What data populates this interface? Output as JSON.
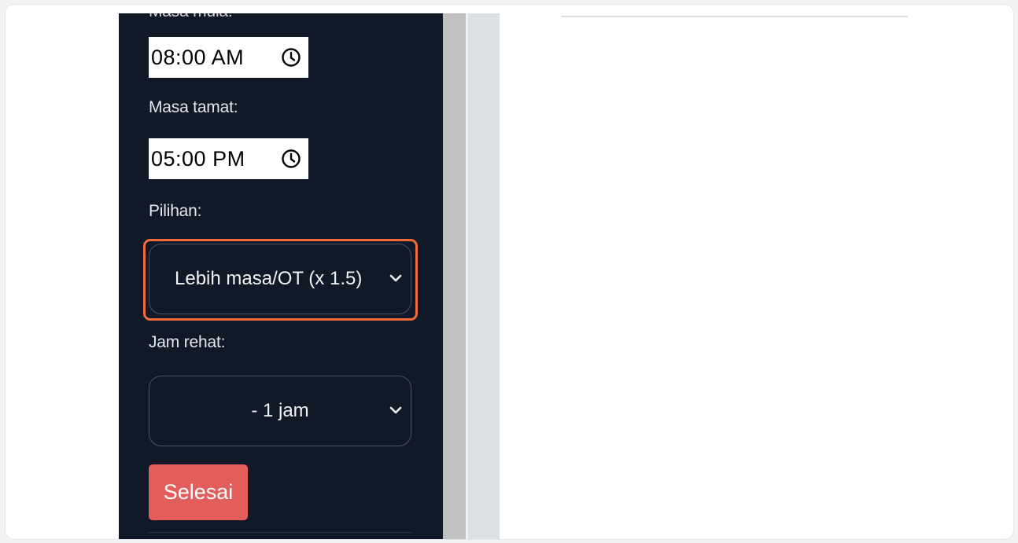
{
  "form": {
    "start_time_label_cut": "Masa mula:",
    "start_time_value": "08:00  AM",
    "end_time_label": "Masa tamat:",
    "end_time_value": "05:00  PM",
    "option_label": "Pilihan:",
    "option_selected": "Lebih masa/OT (x 1.5)",
    "break_label": "Jam rehat:",
    "break_selected": "- 1 jam",
    "submit_label": "Selesai"
  },
  "icons": {
    "time_picker": "clock-icon",
    "dropdown": "chevron-down-icon"
  },
  "colors": {
    "panel_bg": "#111827",
    "focus_ring": "#f26b3a",
    "submit_bg": "#e35d5b"
  }
}
